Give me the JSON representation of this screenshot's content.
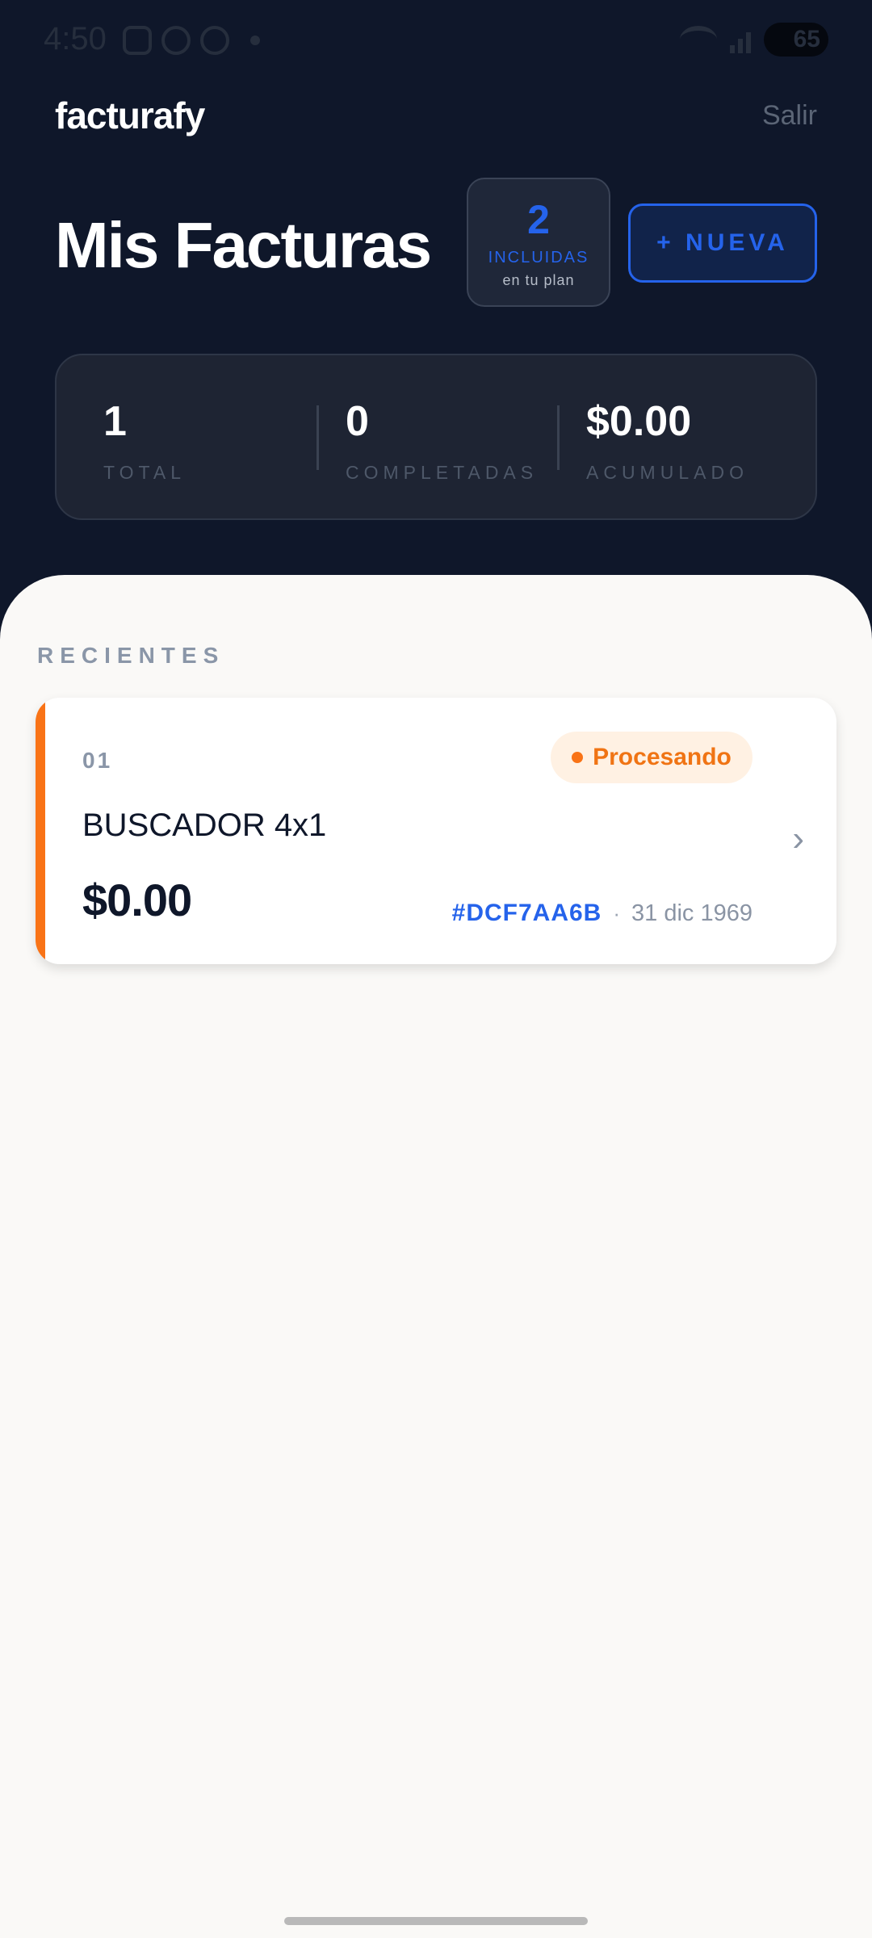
{
  "status_bar": {
    "time": "4:50",
    "battery": "65"
  },
  "header": {
    "brand": "facturafy",
    "logout_label": "Salir",
    "title": "Mis Facturas"
  },
  "plan": {
    "count": "2",
    "label": "INCLUIDAS",
    "sublabel": "en tu plan"
  },
  "new_button": {
    "label": "+ NUEVA"
  },
  "stats": [
    {
      "value": "1",
      "label": "TOTAL"
    },
    {
      "value": "0",
      "label": "COMPLETADAS"
    },
    {
      "value": "$0.00",
      "label": "ACUMULADO"
    }
  ],
  "recent": {
    "title": "RECIENTES",
    "invoices": [
      {
        "number": "01",
        "status": "Procesando",
        "name": "BUSCADOR 4x1",
        "amount": "$0.00",
        "id": "#DCF7AA6B",
        "separator": "·",
        "date": "31 dic 1969",
        "chevron": "›"
      }
    ]
  },
  "colors": {
    "accent": "#2563eb",
    "processing": "#f97316",
    "header_bg": "#0f172a",
    "sheet_bg": "#faf9f7"
  }
}
